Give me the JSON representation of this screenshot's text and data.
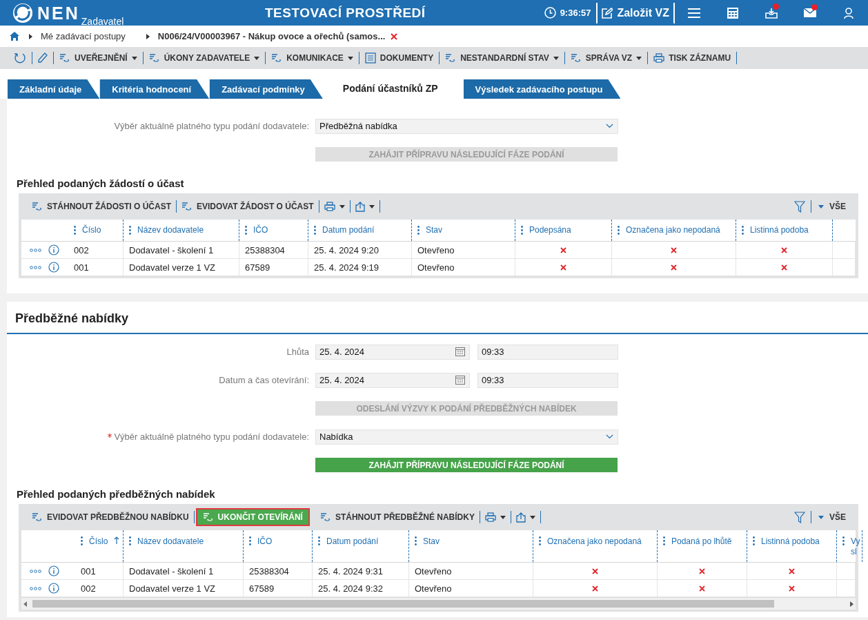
{
  "header": {
    "logo": "NEN",
    "subtitle": "Zadavatel",
    "title": "TESTOVACÍ PROSTŘEDÍ",
    "time": "9:36:57",
    "create_button": "Založit VZ",
    "icons": [
      {
        "kind": "menu",
        "badge": false
      },
      {
        "kind": "calculator",
        "badge": false
      },
      {
        "kind": "inbox",
        "badge": true
      },
      {
        "kind": "mail",
        "badge": true
      },
      {
        "kind": "user",
        "badge": false
      }
    ]
  },
  "breadcrumb": [
    "Mé zadávací postupy",
    "N006/24/V00003967 - Nákup ovoce a ořechů (samos..."
  ],
  "toolbar": [
    {
      "kind": "refresh"
    },
    {
      "kind": "edit"
    },
    {
      "kind": "menu",
      "label": "UVEŘEJNĚNÍ"
    },
    {
      "kind": "menu",
      "label": "ÚKONY ZADAVATELE"
    },
    {
      "kind": "menu",
      "label": "KOMUNIKACE"
    },
    {
      "kind": "doc",
      "label": "DOKUMENTY"
    },
    {
      "kind": "menu",
      "label": "NESTANDARDNÍ STAV"
    },
    {
      "kind": "menu",
      "label": "SPRÁVA VZ"
    },
    {
      "kind": "print",
      "label": "TISK ZÁZNAMU"
    }
  ],
  "tabs": [
    {
      "label": "Základní údaje",
      "selected": false
    },
    {
      "label": "Kritéria hodnocení",
      "selected": false
    },
    {
      "label": "Zadávací podmínky",
      "selected": false
    },
    {
      "label": "Podání účastníků ZP",
      "selected": true
    },
    {
      "label": "Výsledek zadávacího postupu",
      "selected": false
    }
  ],
  "section_1": {
    "fields": [
      {
        "kind": "select",
        "label": "Výběr aktuálně platného typu podání dodavatele:",
        "required": false,
        "value": "Předběžná nabídka"
      },
      {
        "kind": "button",
        "label": "ZAHÁJIT PŘÍPRAVU NÁSLEDUJÍCÍ FÁZE PODÁNÍ",
        "disabled": true
      }
    ],
    "grid": {
      "title": "Přehled podaných žádostí o účast",
      "actions": [
        {
          "kind": "action",
          "label": "STÁHNOUT ŽÁDOSTI O ÚČAST",
          "highlighted": false
        },
        {
          "kind": "action",
          "label": "EVIDOVAT ŽÁDOST O ÚČAST",
          "highlighted": false
        },
        {
          "kind": "print"
        },
        {
          "kind": "export"
        }
      ],
      "filter_label": "VŠE",
      "columns": [
        {
          "label": "Číslo",
          "sorted": false
        },
        {
          "label": "Název dodavatele",
          "sorted": false
        },
        {
          "label": "IČO",
          "sorted": false
        },
        {
          "label": "Datum podání",
          "sorted": false
        },
        {
          "label": "Stav",
          "sorted": false
        },
        {
          "label": "Podepsána",
          "sorted": false
        },
        {
          "label": "Označena jako nepodaná",
          "sorted": false
        },
        {
          "label": "Listinná podoba",
          "sorted": false
        }
      ],
      "rows": [
        {
          "cells": [
            "002",
            "Dodavatel - školení 1",
            "25388304",
            "25. 4. 2024 9:20",
            "Otevřeno"
          ],
          "flags": [
            false,
            false,
            false
          ]
        },
        {
          "cells": [
            "001",
            "Dodavatel verze 1 VZ",
            "67589",
            "25. 4. 2024 9:19",
            "Otevřeno"
          ],
          "flags": [
            false,
            false,
            false
          ]
        }
      ],
      "scrollbar": false
    }
  },
  "section_2": {
    "title": "Předběžné nabídky",
    "fields": [
      {
        "kind": "datetime",
        "label": "Lhůta",
        "required": false,
        "date": "25. 4. 2024",
        "time": "09:33"
      },
      {
        "kind": "datetime",
        "label": "Datum a čas otevírání:",
        "required": false,
        "date": "25. 4. 2024",
        "time": "09:33"
      },
      {
        "kind": "button",
        "label": "ODESLÁNÍ VÝZVY K PODÁNÍ PŘEDBĚŽNÝCH NABÍDEK",
        "disabled": true
      },
      {
        "kind": "select",
        "label": "Výběr aktuálně platného typu podání dodavatele:",
        "required": true,
        "value": "Nabídka"
      },
      {
        "kind": "button",
        "label": "ZAHÁJIT PŘÍPRAVU NÁSLEDUJÍCÍ FÁZE PODÁNÍ",
        "disabled": false
      }
    ],
    "grid": {
      "title": "Přehled podaných předběžných nabídek",
      "actions": [
        {
          "kind": "action",
          "label": "EVIDOVAT PŘEDBĚŽNOU NABÍDKU",
          "highlighted": false
        },
        {
          "kind": "action",
          "label": "UKONČIT OTEVÍRÁNÍ",
          "highlighted": true
        },
        {
          "kind": "action",
          "label": "STÁHNOUT PŘEDBĚŽNÉ NABÍDKY",
          "highlighted": false
        },
        {
          "kind": "print"
        },
        {
          "kind": "export"
        }
      ],
      "filter_label": "VŠE",
      "columns": [
        {
          "label": "Číslo",
          "sorted": true
        },
        {
          "label": "Název dodavatele",
          "sorted": false
        },
        {
          "label": "IČO",
          "sorted": false
        },
        {
          "label": "Datum podání",
          "sorted": false
        },
        {
          "label": "Stav",
          "sorted": false
        },
        {
          "label": "Označena jako nepodaná",
          "sorted": false
        },
        {
          "label": "Podaná po lhůtě",
          "sorted": false
        },
        {
          "label": "Listinná podoba",
          "sorted": false
        },
        {
          "label": "Vy sl",
          "sorted": false
        }
      ],
      "rows": [
        {
          "cells": [
            "001",
            "Dodavatel - školení 1",
            "25388304",
            "25. 4. 2024 9:31",
            "Otevřeno"
          ],
          "flags": [
            false,
            false,
            false
          ]
        },
        {
          "cells": [
            "002",
            "Dodavatel verze 1 VZ",
            "67589",
            "25. 4. 2024 9:32",
            "Otevřeno"
          ],
          "flags": [
            false,
            false,
            false
          ]
        }
      ],
      "scrollbar": true
    }
  }
}
